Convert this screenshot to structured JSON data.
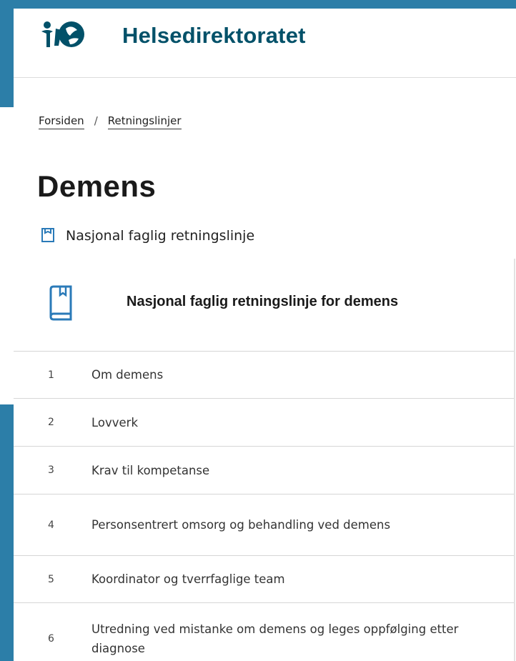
{
  "header": {
    "brand": "Helsedirektoratet",
    "logo_icon": "helsedirektoratet-logo-icon"
  },
  "breadcrumb": {
    "items": [
      "Forsiden",
      "Retningslinjer"
    ],
    "separator": "/"
  },
  "page": {
    "title": "Demens",
    "doc_type": "Nasjonal faglig retningslinje",
    "doc_type_icon": "document-icon"
  },
  "toc": {
    "title": "Nasjonal faglig retningslinje for demens",
    "icon": "book-icon",
    "items": [
      {
        "number": "1",
        "label": "Om demens"
      },
      {
        "number": "2",
        "label": "Lovverk"
      },
      {
        "number": "3",
        "label": "Krav til kompetanse"
      },
      {
        "number": "4",
        "label": "Personsentrert omsorg og behandling ved demens"
      },
      {
        "number": "5",
        "label": "Koordinator og tverrfaglige team"
      },
      {
        "number": "6",
        "label": "Utredning ved mistanke om demens og leges oppfølging etter diagnose"
      }
    ]
  },
  "colors": {
    "brand": "#025169",
    "frame": "#2c7ea8",
    "icon_accent": "#2a7ab8"
  }
}
